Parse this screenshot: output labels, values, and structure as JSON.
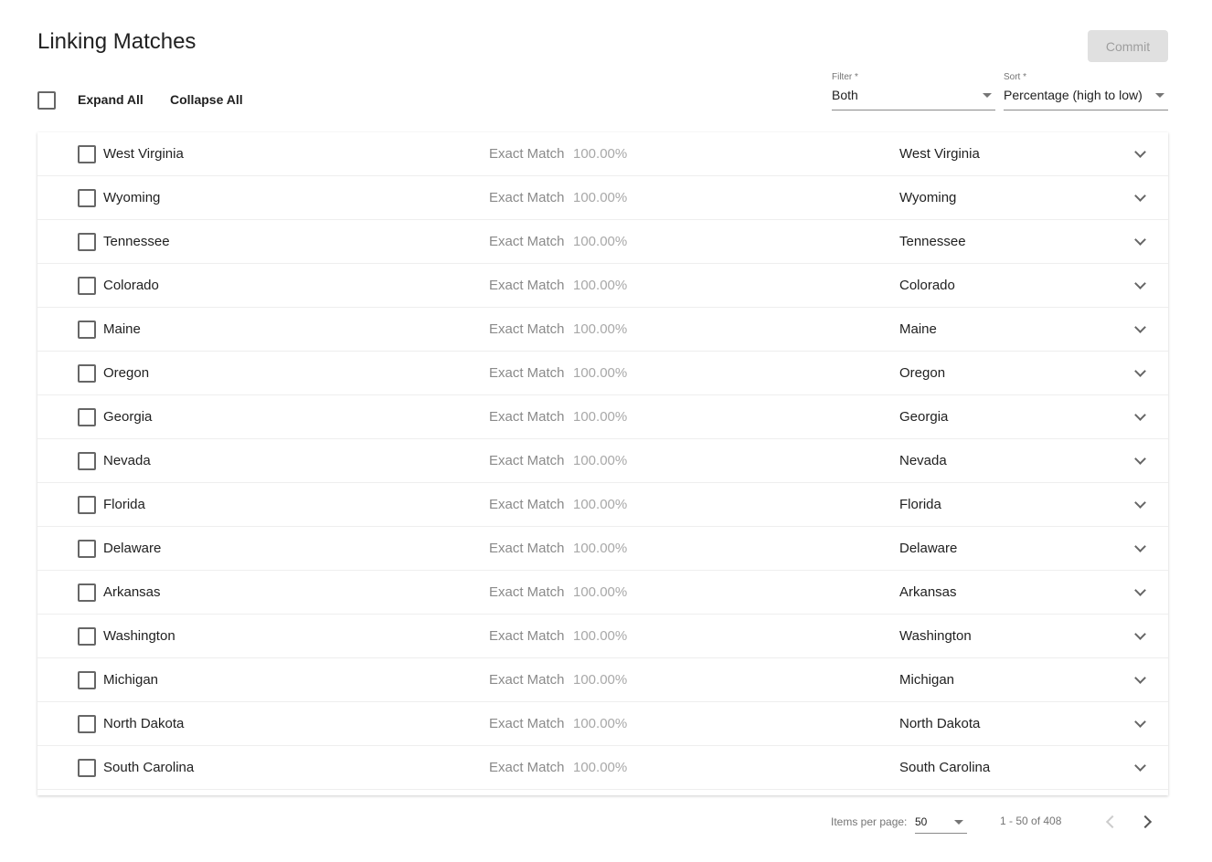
{
  "header": {
    "title": "Linking Matches",
    "commit_label": "Commit"
  },
  "toolbar": {
    "expand_all": "Expand All",
    "collapse_all": "Collapse All"
  },
  "filter": {
    "label": "Filter *",
    "value": "Both"
  },
  "sort": {
    "label": "Sort *",
    "value": "Percentage (high to low)"
  },
  "rows": [
    {
      "source": "West Virginia",
      "match_type": "Exact Match",
      "percent": "100.00%",
      "target": "West Virginia"
    },
    {
      "source": "Wyoming",
      "match_type": "Exact Match",
      "percent": "100.00%",
      "target": "Wyoming"
    },
    {
      "source": "Tennessee",
      "match_type": "Exact Match",
      "percent": "100.00%",
      "target": "Tennessee"
    },
    {
      "source": "Colorado",
      "match_type": "Exact Match",
      "percent": "100.00%",
      "target": "Colorado"
    },
    {
      "source": "Maine",
      "match_type": "Exact Match",
      "percent": "100.00%",
      "target": "Maine"
    },
    {
      "source": "Oregon",
      "match_type": "Exact Match",
      "percent": "100.00%",
      "target": "Oregon"
    },
    {
      "source": "Georgia",
      "match_type": "Exact Match",
      "percent": "100.00%",
      "target": "Georgia"
    },
    {
      "source": "Nevada",
      "match_type": "Exact Match",
      "percent": "100.00%",
      "target": "Nevada"
    },
    {
      "source": "Florida",
      "match_type": "Exact Match",
      "percent": "100.00%",
      "target": "Florida"
    },
    {
      "source": "Delaware",
      "match_type": "Exact Match",
      "percent": "100.00%",
      "target": "Delaware"
    },
    {
      "source": "Arkansas",
      "match_type": "Exact Match",
      "percent": "100.00%",
      "target": "Arkansas"
    },
    {
      "source": "Washington",
      "match_type": "Exact Match",
      "percent": "100.00%",
      "target": "Washington"
    },
    {
      "source": "Michigan",
      "match_type": "Exact Match",
      "percent": "100.00%",
      "target": "Michigan"
    },
    {
      "source": "North Dakota",
      "match_type": "Exact Match",
      "percent": "100.00%",
      "target": "North Dakota"
    },
    {
      "source": "South Carolina",
      "match_type": "Exact Match",
      "percent": "100.00%",
      "target": "South Carolina"
    }
  ],
  "paginator": {
    "items_per_page_label": "Items per page:",
    "items_per_page": "50",
    "range": "1 - 50 of 408"
  }
}
